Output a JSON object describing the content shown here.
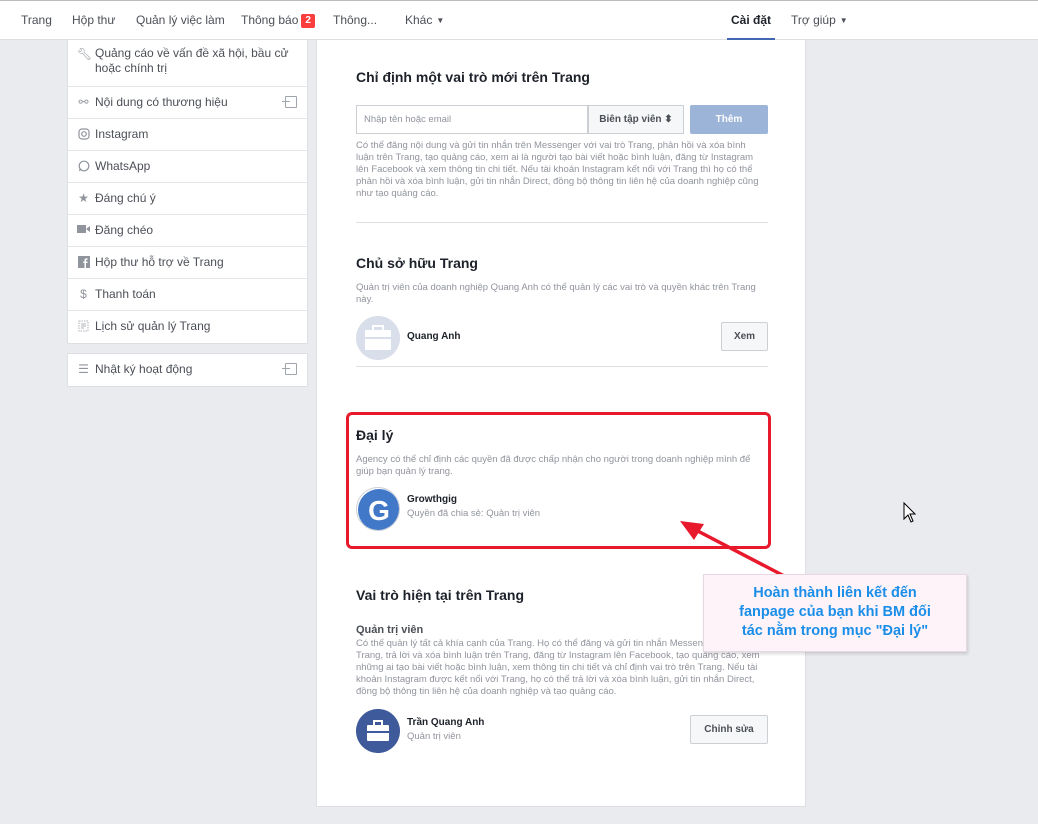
{
  "topnav": {
    "items": [
      "Trang",
      "Hộp thư",
      "Quản lý việc làm",
      "Thông báo",
      "Thông...",
      "Khác"
    ],
    "notification_badge": "2",
    "settings": "Cài đặt",
    "help": "Trợ giúp"
  },
  "sidebar": {
    "items": [
      {
        "label": "Quảng cáo về vấn đề xã hội, bầu cử hoặc chính trị",
        "icon": "wrench-icon"
      },
      {
        "label": "Nội dung có thương hiệu",
        "icon": "handshake-icon"
      },
      {
        "label": "Instagram",
        "icon": "instagram-icon"
      },
      {
        "label": "WhatsApp",
        "icon": "whatsapp-icon"
      },
      {
        "label": "Đáng chú ý",
        "icon": "star-icon"
      },
      {
        "label": "Đăng chéo",
        "icon": "video-icon"
      },
      {
        "label": "Hộp thư hỗ trợ về Trang",
        "icon": "facebook-icon"
      },
      {
        "label": "Thanh toán",
        "icon": "dollar-icon"
      },
      {
        "label": "Lịch sử quản lý Trang",
        "icon": "history-icon"
      }
    ],
    "activity_log": "Nhật ký hoạt động"
  },
  "assign_role": {
    "title": "Chỉ định một vai trò mới trên Trang",
    "input_placeholder": "Nhập tên hoặc email",
    "role_select": "Biên tập viên ⬍",
    "add_button": "Thêm",
    "description": "Có thể đăng nội dung và gửi tin nhắn trên Messenger với vai trò Trang, phản hồi và xóa bình luận trên Trang, tạo quảng cáo, xem ai là người tạo bài viết hoặc bình luận, đăng từ Instagram lên Facebook và xem thông tin chi tiết. Nếu tài khoản Instagram kết nối với Trang thì họ có thể phản hồi và xóa bình luận, gửi tin nhắn Direct, đồng bộ thông tin liên hệ của doanh nghiệp cũng như tạo quảng cáo."
  },
  "owner": {
    "title": "Chủ sở hữu Trang",
    "description": "Quản trị viên của doanh nghiệp Quang Anh có thể quản lý các vai trò và quyền khác trên Trang này.",
    "name": "Quang Anh",
    "view_button": "Xem"
  },
  "agency": {
    "title": "Đại lý",
    "description": "Agency có thể chỉ định các quyền đã được chấp nhận cho người trong doanh nghiệp mình để giúp bạn quản lý trang.",
    "name": "Growthgig",
    "permission": "Quyền đã chia sẻ: Quản trị viên",
    "avatar_letter": "G"
  },
  "current_roles": {
    "title": "Vai trò hiện tại trên Trang",
    "subtitle": "Quản trị viên",
    "description": "Có thể quản lý tất cả khía cạnh của Trang. Họ có thể đăng và gửi tin nhắn Messenger với tư cách Trang, trả lời và xóa bình luận trên Trang, đăng từ Instagram lên Facebook, tạo quảng cáo, xem những ai tạo bài viết hoặc bình luận, xem thông tin chi tiết và chỉ định vai trò trên Trang. Nếu tài khoản Instagram được kết nối với Trang, họ có thể trả lời và xóa bình luận, gửi tin nhắn Direct, đồng bộ thông tin liên hệ của doanh nghiệp và tạo quảng cáo.",
    "name": "Trần Quang Anh",
    "role": "Quản trị viên",
    "edit_button": "Chỉnh sửa"
  },
  "callout": {
    "lines": [
      "Hoàn thành liên kết đến",
      "fanpage của bạn khi BM đối",
      "tác nằm trong mục \"Đại lý\""
    ]
  },
  "colors": {
    "accent": "#4267b2",
    "highlight": "#e8192c",
    "callout_text": "#1a8ee8"
  }
}
